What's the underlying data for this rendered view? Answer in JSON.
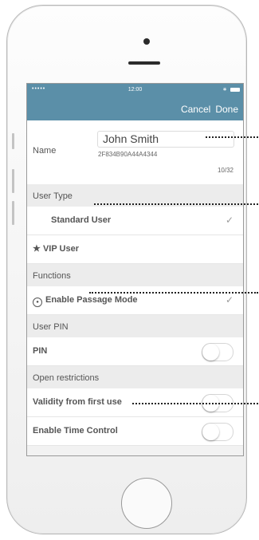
{
  "status_bar": {
    "signal": "•••••",
    "time": "12:00",
    "bluetooth": "∗"
  },
  "nav": {
    "cancel": "Cancel",
    "done": "Done"
  },
  "name_cell": {
    "label": "Name",
    "value": "John Smith",
    "id": "2F834B90A44A4344",
    "count": "10/32"
  },
  "user_type": {
    "header": "User Type",
    "standard": "Standard User",
    "vip": "VIP User",
    "selected": "Standard User"
  },
  "functions": {
    "header": "Functions",
    "passage_mode": "Enable Passage Mode"
  },
  "pin": {
    "header": "User PIN",
    "label": "PIN"
  },
  "restrictions": {
    "header": "Open restrictions",
    "validity": "Validity from first use",
    "time_control": "Enable Time Control"
  },
  "icons": {
    "check": "checkmark-icon",
    "star": "star-icon",
    "lock": "lock-icon"
  },
  "colors": {
    "navbar": "#5b8fa8"
  }
}
